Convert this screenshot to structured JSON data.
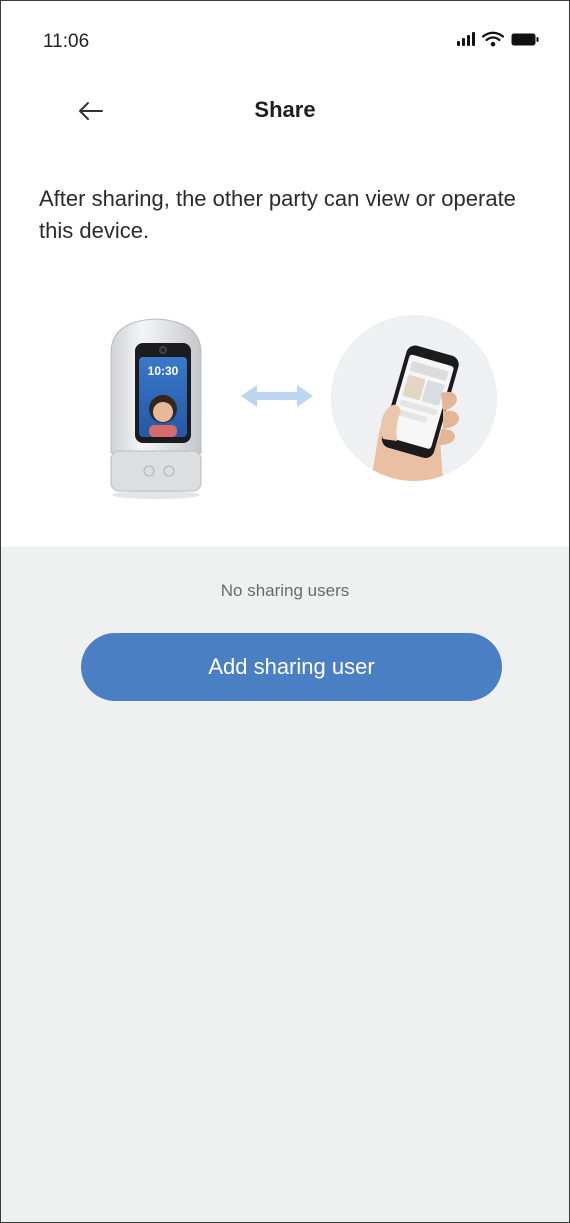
{
  "status_bar": {
    "time": "11:06",
    "icons": [
      "signal-icon",
      "wifi-icon",
      "battery-icon"
    ]
  },
  "header": {
    "back_icon": "arrow-left-icon",
    "title": "Share"
  },
  "description": "After sharing, the other party can view or operate this device.",
  "illustration": {
    "device_screen_time": "10:30",
    "icons": [
      "smart-device-image",
      "double-arrow-icon",
      "hand-phone-image"
    ]
  },
  "sharing": {
    "empty_text": "No sharing users",
    "add_button_label": "Add sharing user"
  },
  "colors": {
    "accent": "#4a7fc4",
    "background_grey": "#eff0f0",
    "arrow": "#bcd6ef"
  }
}
